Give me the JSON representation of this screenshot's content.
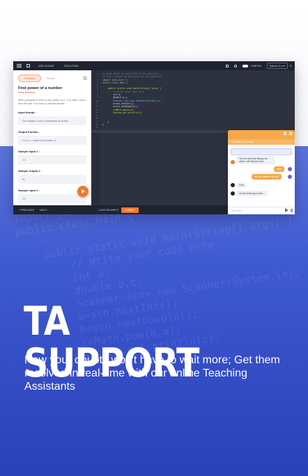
{
  "headline": "TA SUPPORT",
  "body": "Now your doubts won't have to wait more; Get them resolved in real-time with our online Teaching Assistants",
  "background_code": "import java.util.*;\npublic class Main {\n\n    public static void main(String[] args) {\n        // Write your code here\n        int a;\n        double b,c;\n        Scanner scn= new Scanner(System.in);\n        a=scn.nextInt();\n        b=scn.nextDouble();\n        c=Math.pow(b,a);\n        System.out.println(c);",
  "colors": {
    "accent_orange": "#f4772b",
    "chat_header": "#f6a84a",
    "background_blue": "#3f5ad2",
    "editor_bg": "#2e3240"
  },
  "screenshot": {
    "topbar": {
      "ask_doubt": "ASK DOUBT",
      "solution": "SOLUTION",
      "mode": "Chill Pal",
      "language": "Python 3.x"
    },
    "problem": {
      "tab_active": "Problem",
      "tab_other": "Result",
      "title": "Find power of a number",
      "difficulty": "Small (Medium)",
      "description": "Write a program to find x to the power n (i.e. x^n). Take x and n from the user. You need to print the answer.",
      "input_label": "Input format :",
      "input_value": "Two integers x and n (separated by space)",
      "output_label": "Output Format :",
      "output_value": "x^n (i.e. x raise to the power n)",
      "sample_input_1_label": "Sample Input 1 :",
      "sample_input_1": "3 4",
      "sample_output_1_label": "Sample Output 1 :",
      "sample_output_1": "81",
      "sample_input_2_label": "Sample Input 2 :",
      "sample_input_2": "2 5"
    },
    "editor": {
      "line_numbers": "1\n2\n3\n4\n5\n6\n7\n8\n9\n10\n11\n12\n13\n14\n15\n16\n17\n18\n19\n20",
      "comment_1": "// Read input as specified in the question.",
      "comment_2": "// Print output as specified in the question.",
      "import_line": "import java.util.*;",
      "class_line": "public class Main {",
      "main_line": "    public static void main(String[] args) {",
      "write_comment": "        // Write your code here",
      "line_a": "        int a;",
      "line_b": "        double b,c;",
      "line_scn": "        Scanner scn= new Scanner(System.in);",
      "line_next_int": "        a=scn.nextInt();",
      "line_next_double": "        b=scn.nextDouble();",
      "line_pow": "        c=Math.pow(b,a);",
      "line_print": "        System.out.println(c);",
      "close_1": "    }",
      "close_2": "}"
    },
    "bottombar": {
      "previous": "PREVIOUS",
      "next": "NEXT",
      "custom_input": "CUSTOM INPUT",
      "submit": "SUBMIT"
    },
    "chat": {
      "subtitle": "Connect to Ta Rahul",
      "msg_1": "TAs are currently helping our others, will respond soon",
      "msg_2": "okay",
      "msg_3": "can you please help me?",
      "msg_4": "Sure",
      "msg_5": "Let me check your code...",
      "type_placeholder": "Type here..."
    }
  }
}
